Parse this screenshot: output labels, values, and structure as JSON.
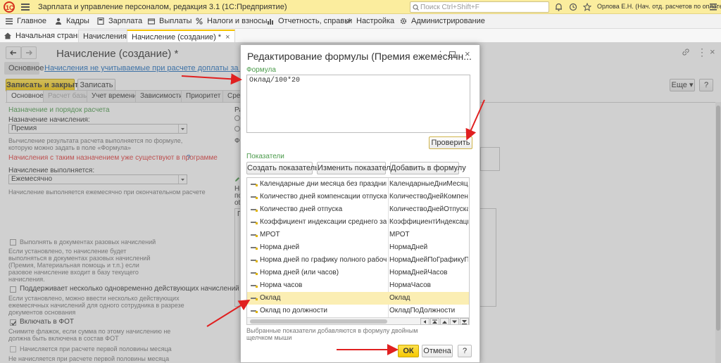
{
  "titlebar": {
    "app_title": "Зарплата и управление персоналом, редакция 3.1  (1С:Предприятие)",
    "search_placeholder": "Поиск Ctrl+Shift+F",
    "user": "Орлова Е.Н. (Нач. отд. расчетов по оплате труда)"
  },
  "main_menu": [
    "Главное",
    "Кадры",
    "Зарплата",
    "Выплаты",
    "Налоги и взносы",
    "Отчетность, справки",
    "Настройка",
    "Администрирование"
  ],
  "tabs": [
    "Начальная страница",
    "Начисления",
    "Начисление (создание) *"
  ],
  "form": {
    "title": "Начисление (создание) *",
    "subtab_main": "Основное",
    "subtab_link": "Начисления не учитываемые при расчете доплаты за совмещение",
    "save_close": "Записать и закрыть",
    "save": "Записать",
    "more": "Еще",
    "help": "?",
    "tabs": [
      "Основное",
      "Расчет базы",
      "Учет времени",
      "Зависимости",
      "Приоритет",
      "Сред"
    ],
    "section_title": "Назначение и порядок расчета",
    "purpose_label": "Назначение начисления:",
    "purpose_value": "Премия",
    "purpose_hint_1": "Вычисление результата расчета выполняется по формуле,",
    "purpose_hint_2": "которую можно задать в поле «Формула»",
    "warning": "Начисления с таким назначением уже существуют в программе",
    "warning_q": "?",
    "performed_label": "Начисление выполняется:",
    "performed_value": "Ежемесячно",
    "performed_hint": "Начисление выполняется ежемесячно при окончательном расчете",
    "right_col": {
      "r1": "Ра",
      "r3": "Фо",
      "r4": "Ни",
      "r5": "по",
      "r6": "ot",
      "r7": "П"
    },
    "opt1_label": "Выполнять в документах разовых начислений",
    "opt1_hint": [
      "Если установлено, то начисление будет",
      "выполняться в документах разовых начислений",
      "(Премия, Материальная помощь и т.п.) если",
      "разовое начисление входит в базу текущего",
      "начисления."
    ],
    "opt2_label": "Поддерживает несколько одновременно действующих начислений",
    "opt2_hint": [
      "Если установлено, можно ввести несколько действующих",
      "ежемесячных начислений для одного сотрудника в разрезе",
      "документов основания"
    ],
    "opt3_label": "Включать в ФОТ",
    "opt3_hint": [
      "Снимите флажок, если сумма по этому начислению не",
      "должна быть включена в состав ФОТ"
    ],
    "opt4_label": "Начисляется при расчете первой половины месяца",
    "opt5_label": "Не начисляется при расчете первой половины месяца"
  },
  "modal": {
    "title": "Редактирование формулы (Премия ежемесячн...",
    "formula_label": "Формула",
    "formula_value": "Оклад/100*20",
    "check_button": "Проверить",
    "indicators_label": "Показатели",
    "btn_create": "Создать показатель",
    "btn_change": "Изменить показатель",
    "btn_add": "Добавить в формулу",
    "rows": [
      {
        "name": "Календарные дни месяца без праздников",
        "id": "КалендарныеДниМесяцаБезП"
      },
      {
        "name": "Количество дней компенсации отпуска",
        "id": "КоличествоДнейКомпенсации"
      },
      {
        "name": "Количество дней отпуска",
        "id": "КоличествоДнейОтпуска"
      },
      {
        "name": "Коэффициент индексации среднего зарабо...",
        "id": "КоэффициентИндексацииСре"
      },
      {
        "name": "МРОТ",
        "id": "МРОТ"
      },
      {
        "name": "Норма дней",
        "id": "НормаДней"
      },
      {
        "name": "Норма дней по графику полного рабочего ...",
        "id": "НормаДнейПоГрафикуПолного"
      },
      {
        "name": "Норма дней (или часов)",
        "id": "НормаДнейЧасов"
      },
      {
        "name": "Норма часов",
        "id": "НормаЧасов"
      },
      {
        "name": "Оклад",
        "id": "Оклад"
      },
      {
        "name": "Оклад по должности",
        "id": "ОкладПоДолжности"
      }
    ],
    "selected_row": 9,
    "footer_hint_1": "Выбранные показатели добавляются в формулу двойным",
    "footer_hint_2": "щелчком мыши",
    "ok": "ОК",
    "cancel": "Отмена",
    "help": "?"
  },
  "colors": {
    "accent": "#f4c200",
    "arrow": "#e02020",
    "link": "#1f6fbf",
    "green_text": "#4a9a4a"
  }
}
